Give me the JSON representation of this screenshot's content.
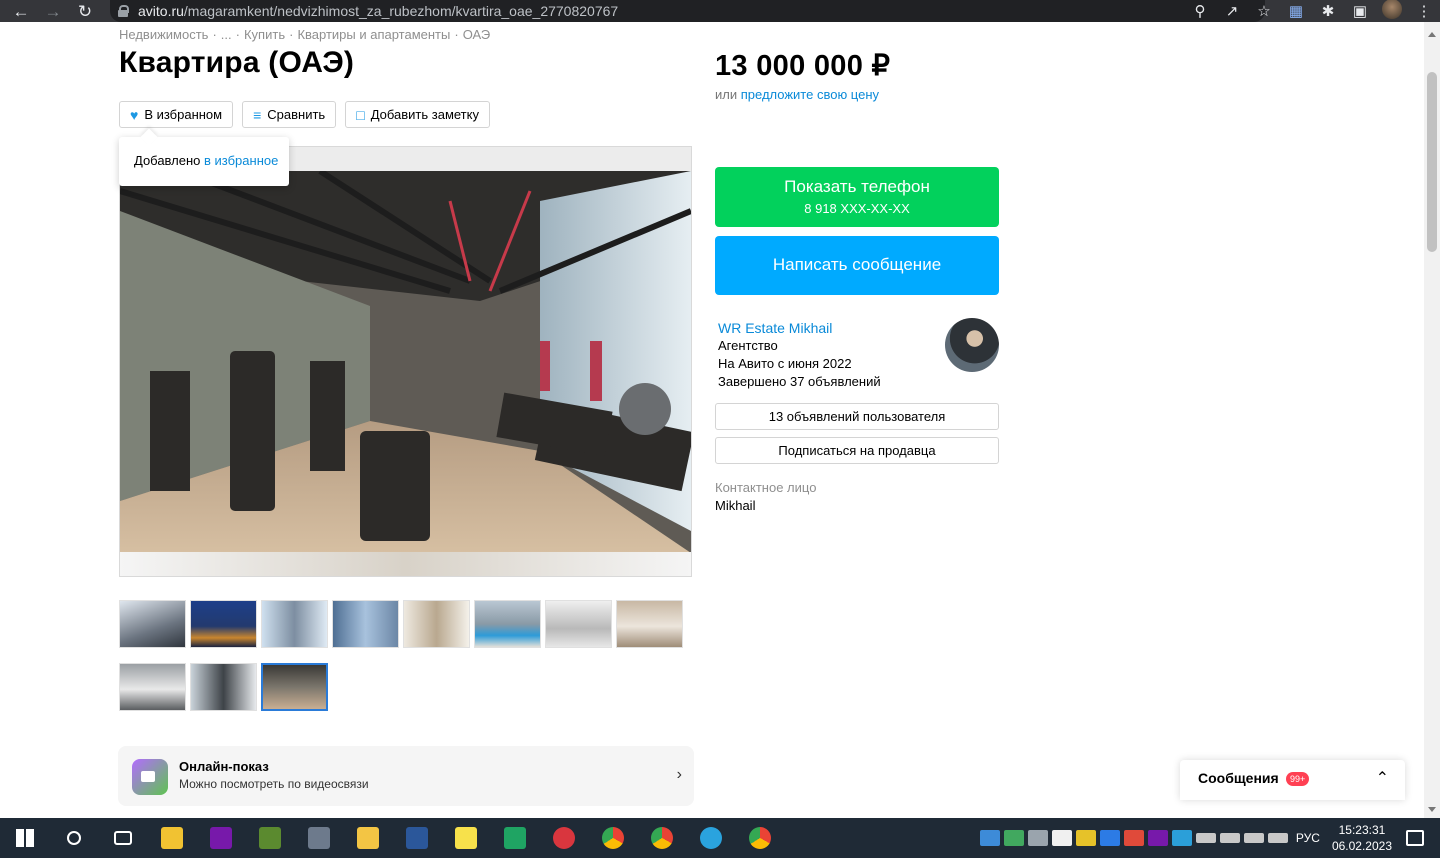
{
  "browser": {
    "url_domain": "avito.ru",
    "url_path": "/magaramkent/nedvizhimost_za_rubezhom/kvartira_oae_2770820767"
  },
  "breadcrumbs": [
    "Недвижимость",
    "·",
    "...",
    "·",
    "Купить",
    "·",
    "Квартиры и апартаменты",
    "·",
    "ОАЭ"
  ],
  "listing": {
    "title": "Квартира (ОАЭ)",
    "actions": {
      "favorite": "В избранном",
      "compare": "Сравнить",
      "note": "Добавить заметку"
    },
    "tooltip_prefix": "Добавлено",
    "tooltip_link": "в избранное",
    "thumbnail_count": 11,
    "selected_thumbnail": 11
  },
  "online_show": {
    "title": "Онлайн-показ",
    "subtitle": "Можно посмотреть по видеосвязи"
  },
  "price": {
    "value": "13 000 000 ₽",
    "offer_prefix": "или",
    "offer_link": "предложите свою цену"
  },
  "contact": {
    "show_phone": "Показать телефон",
    "phone_masked": "8 918 XXX-XX-XX",
    "write_message": "Написать сообщение"
  },
  "seller": {
    "name": "WR Estate Mikhail",
    "type": "Агентство",
    "since": "На Авито с июня 2022",
    "completed": "Завершено 37 объявлений",
    "listings_button": "13 объявлений пользователя",
    "subscribe_button": "Подписаться на продавца",
    "contact_label": "Контактное лицо",
    "contact_name": "Mikhail"
  },
  "messages": {
    "label": "Сообщения",
    "badge": "99+"
  },
  "taskbar": {
    "language": "РУС",
    "time": "15:23:31",
    "date": "06.02.2023"
  },
  "colors": {
    "green": "#02d15c",
    "blue": "#00aaff",
    "link": "#0a8ad8"
  }
}
